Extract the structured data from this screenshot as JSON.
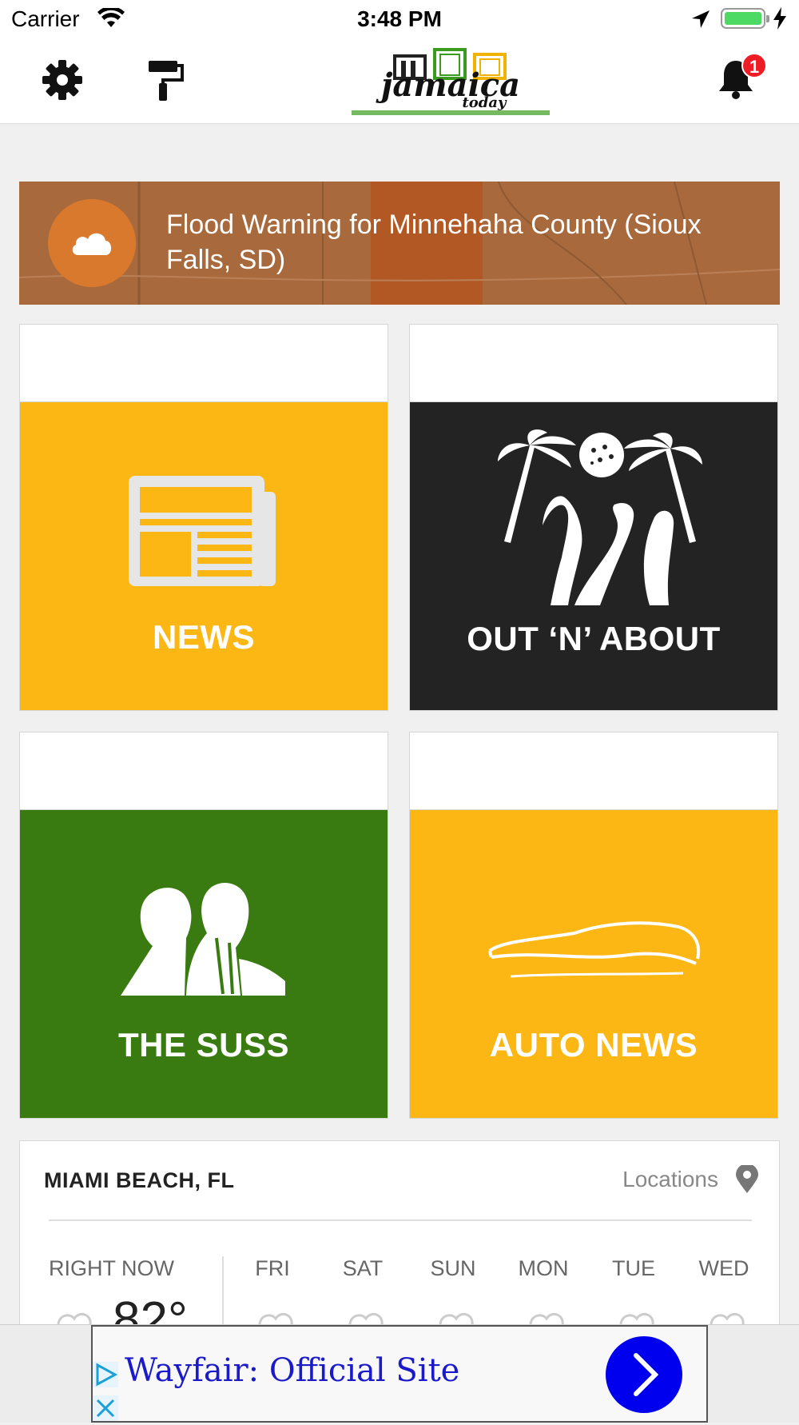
{
  "status_bar": {
    "carrier": "Carrier",
    "time": "3:48 PM"
  },
  "nav": {
    "notification_count": "1"
  },
  "alert": {
    "text": "Flood Warning for Minnehaha County (Sioux Falls, SD)"
  },
  "tiles": [
    {
      "label": "NEWS",
      "color": "#fdb714"
    },
    {
      "label": "OUT ‘N’ ABOUT",
      "color": "#232323"
    },
    {
      "label": "THE SUSS",
      "color": "#397b10"
    },
    {
      "label": "AUTO NEWS",
      "color": "#fdb714"
    }
  ],
  "weather": {
    "city": "MIAMI BEACH, FL",
    "locations_label": "Locations",
    "now_label": "RIGHT NOW",
    "current_temp": "82°",
    "days": [
      "FRI",
      "SAT",
      "SUN",
      "MON",
      "TUE",
      "WED"
    ]
  },
  "ad": {
    "title": "Wayfair: Official Site"
  }
}
